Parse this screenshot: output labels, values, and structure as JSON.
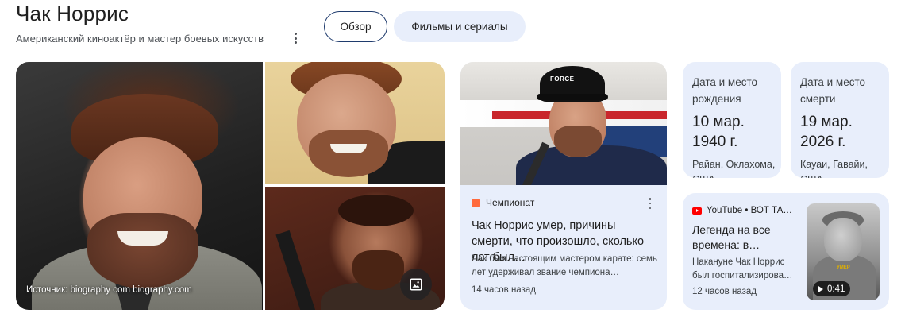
{
  "header": {
    "title": "Чак Норрис",
    "subtitle": "Американский киноактёр и мастер боевых искусств",
    "more_icon": "more-vert-icon"
  },
  "tabs": [
    {
      "label": "Обзор",
      "selected": true
    },
    {
      "label": "Фильмы и сериалы",
      "selected": false
    }
  ],
  "gallery": {
    "caption": "Источник: biography com biography.com",
    "image_search_icon": "image-icon"
  },
  "news_card": {
    "source": "Чемпионат",
    "source_icon": "championat-logo-icon",
    "thumbnail_cap_text": "FORCE",
    "headline": "Чак Норрис умер, причины смерти, что произошло, сколько лет был…",
    "snippet": "Чак был настоящим мастером карате: семь лет удерживал звание чемпиона…",
    "time": "14 часов назад"
  },
  "facts": [
    {
      "label": "Дата и место рождения",
      "date": "10 мар. 1940 г.",
      "place": "Райан, Оклахома, США"
    },
    {
      "label": "Дата и место смерти",
      "date": "19 мар. 2026 г.",
      "place": "Кауаи, Гавайи, США"
    }
  ],
  "video_card": {
    "source": "YouTube • ВОТ ТА…",
    "source_icon": "youtube-icon",
    "headline": "Легенда на все времена: в…",
    "snippet": "Накануне Чак Норрис был госпитализирова…",
    "time": "12 часов назад",
    "thumbnail_tag": "УМЕР",
    "duration": "0:41"
  },
  "colors": {
    "card_bg": "#e8eefb",
    "tab_border": "#1f3b6d",
    "youtube_red": "#ff0000"
  }
}
